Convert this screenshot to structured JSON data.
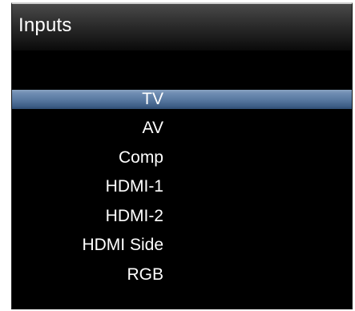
{
  "header": {
    "title": "Inputs"
  },
  "inputs": {
    "selected_index": 0,
    "items": [
      {
        "label": "TV"
      },
      {
        "label": "AV"
      },
      {
        "label": "Comp"
      },
      {
        "label": "HDMI-1"
      },
      {
        "label": "HDMI-2"
      },
      {
        "label": "HDMI Side"
      },
      {
        "label": "RGB"
      }
    ]
  },
  "colors": {
    "background": "#000000",
    "text": "#ffffff",
    "selection": "#5a7aa2"
  }
}
